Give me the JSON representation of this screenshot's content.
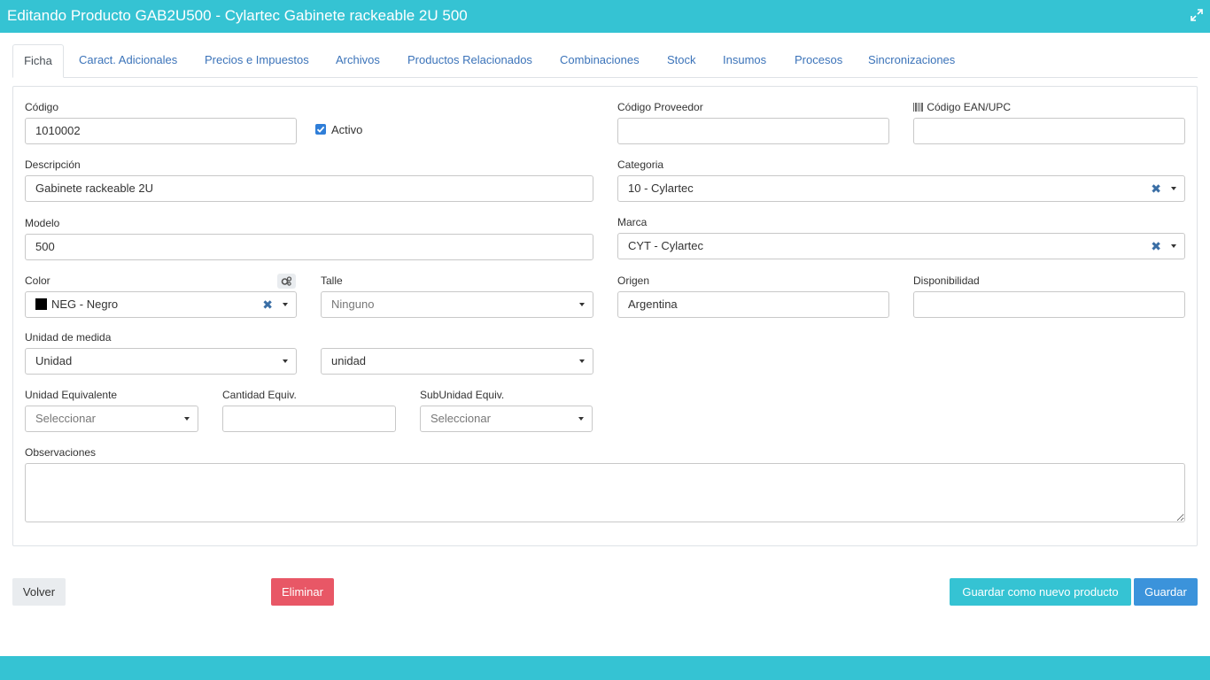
{
  "window": {
    "title": "Editando Producto GAB2U500 - Cylartec Gabinete rackeable 2U 500"
  },
  "tabs": [
    {
      "label": "Ficha",
      "active": true
    },
    {
      "label": "Caract. Adicionales"
    },
    {
      "label": "Precios e Impuestos"
    },
    {
      "label": "Archivos"
    },
    {
      "label": "Productos Relacionados"
    },
    {
      "label": "Combinaciones"
    },
    {
      "label": "Stock"
    },
    {
      "label": "Insumos"
    },
    {
      "label": "Procesos"
    },
    {
      "label": "Sincronizaciones"
    }
  ],
  "form": {
    "codigo": {
      "label": "Código",
      "value": "1010002"
    },
    "activo": {
      "label": "Activo",
      "checked": true
    },
    "codigo_proveedor": {
      "label": "Código Proveedor",
      "value": ""
    },
    "codigo_ean": {
      "label": "Código EAN/UPC",
      "value": "",
      "icon": "barcode-icon"
    },
    "descripcion": {
      "label": "Descripción",
      "value": "Gabinete rackeable 2U"
    },
    "categoria": {
      "label": "Categoria",
      "value": "10 - Cylartec",
      "clear": "✖"
    },
    "modelo": {
      "label": "Modelo",
      "value": "500"
    },
    "marca": {
      "label": "Marca",
      "value": "CYT - Cylartec",
      "clear": "✖"
    },
    "color": {
      "label": "Color",
      "value": "NEG - Negro",
      "swatch": "#000000",
      "clear": "✖"
    },
    "talle": {
      "label": "Talle",
      "placeholder": "Ninguno"
    },
    "origen": {
      "label": "Origen",
      "value": "Argentina"
    },
    "disponibilidad": {
      "label": "Disponibilidad",
      "value": ""
    },
    "unidad_medida": {
      "label": "Unidad de medida",
      "value": "Unidad",
      "value2": "unidad"
    },
    "unidad_equivalente": {
      "label": "Unidad Equivalente",
      "placeholder": "Seleccionar"
    },
    "cantidad_equiv": {
      "label": "Cantidad Equiv.",
      "value": ""
    },
    "subunidad_equiv": {
      "label": "SubUnidad Equiv.",
      "placeholder": "Seleccionar"
    },
    "observaciones": {
      "label": "Observaciones",
      "value": ""
    }
  },
  "buttons": {
    "volver": "Volver",
    "eliminar": "Eliminar",
    "guardar_nuevo": "Guardar como nuevo producto",
    "guardar": "Guardar"
  },
  "colors": {
    "header": "#35c3d3",
    "link": "#3b73b9",
    "danger": "#e85766",
    "info": "#35c3d3",
    "primary": "#3b93db"
  }
}
